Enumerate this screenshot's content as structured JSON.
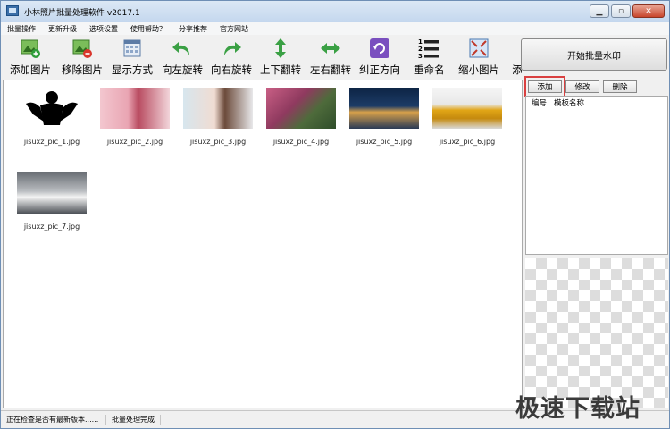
{
  "window": {
    "title": "小林照片批量处理软件 v2017.1",
    "controls": [
      "minimize",
      "maximize",
      "close"
    ]
  },
  "menu": [
    "批量操作",
    "更新升级",
    "选项设置",
    "使用帮助？",
    "分享推荐",
    "官方网站"
  ],
  "toolbar": [
    {
      "label": "添加图片",
      "icon": "add-image-icon"
    },
    {
      "label": "移除图片",
      "icon": "remove-image-icon"
    },
    {
      "label": "显示方式",
      "icon": "display-mode-icon"
    },
    {
      "label": "向左旋转",
      "icon": "rotate-left-icon"
    },
    {
      "label": "向右旋转",
      "icon": "rotate-right-icon"
    },
    {
      "label": "上下翻转",
      "icon": "flip-vertical-icon"
    },
    {
      "label": "左右翻转",
      "icon": "flip-horizontal-icon"
    },
    {
      "label": "纠正方向",
      "icon": "correct-orientation-icon"
    },
    {
      "label": "重命名",
      "icon": "rename-list-icon"
    },
    {
      "label": "缩小图片",
      "icon": "shrink-image-icon"
    },
    {
      "label": "添",
      "icon": "more-icon"
    }
  ],
  "start_button": "开始批量水印",
  "images": [
    {
      "name": "jisuxz_pic_1.jpg"
    },
    {
      "name": "jisuxz_pic_2.jpg"
    },
    {
      "name": "jisuxz_pic_3.jpg"
    },
    {
      "name": "jisuxz_pic_4.jpg"
    },
    {
      "name": "jisuxz_pic_5.jpg"
    },
    {
      "name": "jisuxz_pic_6.jpg"
    },
    {
      "name": "jisuxz_pic_7.jpg"
    }
  ],
  "template_panel": {
    "buttons": {
      "add": "添加",
      "edit": "修改",
      "delete": "删除"
    },
    "columns": [
      "编号",
      "模板名称"
    ]
  },
  "status": {
    "left": "正在检查是否有最新版本......",
    "right": "批量处理完成"
  },
  "watermark": "极速下载站",
  "colors": {
    "highlight": "#d94040",
    "title_bar": "#c4d7ee",
    "close_button": "#c8452c"
  }
}
